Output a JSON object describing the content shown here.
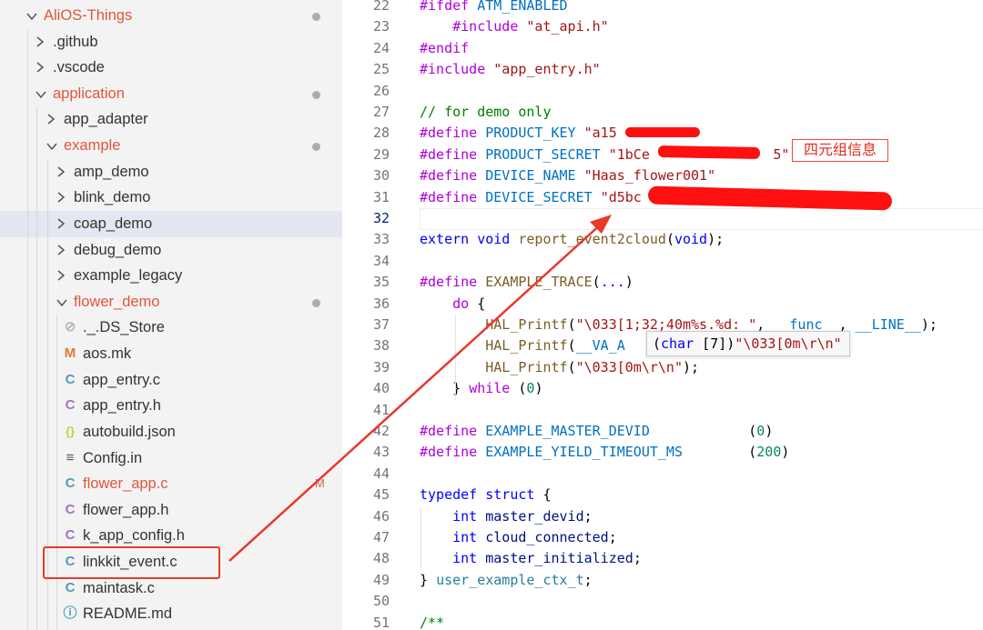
{
  "explorer": {
    "items": [
      {
        "label": "AliOS-Things",
        "kind": "folder-open",
        "depth": 0,
        "color": "#e0563b",
        "status": "dot"
      },
      {
        "label": ".github",
        "kind": "folder",
        "depth": 1,
        "color": "#333333"
      },
      {
        "label": ".vscode",
        "kind": "folder",
        "depth": 1,
        "color": "#333333"
      },
      {
        "label": "application",
        "kind": "folder-open",
        "depth": 1,
        "color": "#e0563b",
        "status": "dot"
      },
      {
        "label": "app_adapter",
        "kind": "folder",
        "depth": 2,
        "color": "#333333"
      },
      {
        "label": "example",
        "kind": "folder-open",
        "depth": 2,
        "color": "#e0563b",
        "status": "dot"
      },
      {
        "label": "amp_demo",
        "kind": "folder",
        "depth": 3,
        "color": "#333333"
      },
      {
        "label": "blink_demo",
        "kind": "folder",
        "depth": 3,
        "color": "#333333"
      },
      {
        "label": "coap_demo",
        "kind": "folder",
        "depth": 3,
        "color": "#333333",
        "selected": true
      },
      {
        "label": "debug_demo",
        "kind": "folder",
        "depth": 3,
        "color": "#333333"
      },
      {
        "label": "example_legacy",
        "kind": "folder",
        "depth": 3,
        "color": "#333333"
      },
      {
        "label": "flower_demo",
        "kind": "folder-open",
        "depth": 3,
        "color": "#e0563b",
        "status": "dot"
      },
      {
        "label": "._.DS_Store",
        "kind": "file",
        "icon": "hidden-eye-icon",
        "icon_char": "⊘",
        "icon_color": "#b7b7b7",
        "depth": 4,
        "color": "#333333"
      },
      {
        "label": "aos.mk",
        "kind": "file",
        "icon": "makefile-icon",
        "icon_char": "M",
        "icon_color": "#e37933",
        "depth": 4,
        "color": "#333333"
      },
      {
        "label": "app_entry.c",
        "kind": "file",
        "icon": "c-file-icon",
        "icon_char": "C",
        "icon_color": "#519aba",
        "depth": 4,
        "color": "#333333"
      },
      {
        "label": "app_entry.h",
        "kind": "file",
        "icon": "h-file-icon",
        "icon_char": "C",
        "icon_color": "#a074c4",
        "depth": 4,
        "color": "#333333"
      },
      {
        "label": "autobuild.json",
        "kind": "file",
        "icon": "json-file-icon",
        "icon_char": "{}",
        "icon_color": "#cbcb41",
        "depth": 4,
        "color": "#333333"
      },
      {
        "label": "Config.in",
        "kind": "file",
        "icon": "config-file-icon",
        "icon_char": "≡",
        "icon_color": "#555555",
        "depth": 4,
        "color": "#333333"
      },
      {
        "label": "flower_app.c",
        "kind": "file",
        "icon": "c-file-icon",
        "icon_char": "C",
        "icon_color": "#519aba",
        "depth": 4,
        "color": "#e0563b",
        "status": "M"
      },
      {
        "label": "flower_app.h",
        "kind": "file",
        "icon": "h-file-icon",
        "icon_char": "C",
        "icon_color": "#a074c4",
        "depth": 4,
        "color": "#333333"
      },
      {
        "label": "k_app_config.h",
        "kind": "file",
        "icon": "h-file-icon",
        "icon_char": "C",
        "icon_color": "#a074c4",
        "depth": 4,
        "color": "#333333"
      },
      {
        "label": "linkkit_event.c",
        "kind": "file",
        "icon": "c-file-icon",
        "icon_char": "C",
        "icon_color": "#519aba",
        "depth": 4,
        "color": "#333333",
        "highlighted": true
      },
      {
        "label": "maintask.c",
        "kind": "file",
        "icon": "c-file-icon",
        "icon_char": "C",
        "icon_color": "#519aba",
        "depth": 4,
        "color": "#333333"
      },
      {
        "label": "README.md",
        "kind": "file",
        "icon": "info-icon",
        "icon_char": "ⓘ",
        "icon_color": "#519aba",
        "depth": 4,
        "color": "#333333"
      }
    ]
  },
  "editor": {
    "current_line": 32,
    "lines": [
      {
        "n": "22",
        "indent": 0,
        "tokens": [
          [
            "pp",
            "#ifdef"
          ],
          [
            "tx",
            " "
          ],
          [
            "mc",
            "ATM_ENABLED"
          ]
        ]
      },
      {
        "n": "23",
        "indent": 1,
        "tokens": [
          [
            "pp",
            "    #include"
          ],
          [
            "tx",
            " "
          ],
          [
            "st",
            "\"at_api.h\""
          ]
        ]
      },
      {
        "n": "24",
        "indent": 0,
        "tokens": [
          [
            "pp",
            "#endif"
          ]
        ]
      },
      {
        "n": "25",
        "indent": 0,
        "tokens": [
          [
            "pp",
            "#include"
          ],
          [
            "tx",
            " "
          ],
          [
            "st",
            "\"app_entry.h\""
          ]
        ]
      },
      {
        "n": "26",
        "indent": 0,
        "tokens": []
      },
      {
        "n": "27",
        "indent": 0,
        "tokens": [
          [
            "cm",
            "// for demo only"
          ]
        ]
      },
      {
        "n": "28",
        "indent": 0,
        "tokens": [
          [
            "pp",
            "#define"
          ],
          [
            "tx",
            " "
          ],
          [
            "mc",
            "PRODUCT_KEY"
          ],
          [
            "tx",
            " "
          ],
          [
            "st",
            "\"a15"
          ]
        ]
      },
      {
        "n": "29",
        "indent": 0,
        "tokens": [
          [
            "pp",
            "#define"
          ],
          [
            "tx",
            " "
          ],
          [
            "mc",
            "PRODUCT_SECRET"
          ],
          [
            "tx",
            " "
          ],
          [
            "st",
            "\"1bCe               5\""
          ]
        ]
      },
      {
        "n": "30",
        "indent": 0,
        "tokens": [
          [
            "pp",
            "#define"
          ],
          [
            "tx",
            " "
          ],
          [
            "mc",
            "DEVICE_NAME"
          ],
          [
            "tx",
            " "
          ],
          [
            "st",
            "\"Haas_flower001\""
          ]
        ]
      },
      {
        "n": "31",
        "indent": 0,
        "tokens": [
          [
            "pp",
            "#define"
          ],
          [
            "tx",
            " "
          ],
          [
            "mc",
            "DEVICE_SECRET"
          ],
          [
            "tx",
            " "
          ],
          [
            "st",
            "\"d5bc                           \""
          ]
        ]
      },
      {
        "n": "32",
        "indent": 0,
        "tokens": []
      },
      {
        "n": "33",
        "indent": 0,
        "tokens": [
          [
            "kw",
            "extern"
          ],
          [
            "tx",
            " "
          ],
          [
            "ty",
            "void"
          ],
          [
            "tx",
            " "
          ],
          [
            "fn",
            "report_event2cloud"
          ],
          [
            "tx",
            "("
          ],
          [
            "ty",
            "void"
          ],
          [
            "tx",
            ");"
          ]
        ]
      },
      {
        "n": "34",
        "indent": 0,
        "tokens": []
      },
      {
        "n": "35",
        "indent": 0,
        "tokens": [
          [
            "pp",
            "#define"
          ],
          [
            "tx",
            " "
          ],
          [
            "fn",
            "EXAMPLE_TRACE"
          ],
          [
            "tx",
            "("
          ],
          [
            "kw",
            "..."
          ],
          [
            "tx",
            ")"
          ]
        ]
      },
      {
        "n": "36",
        "indent": 1,
        "tokens": [
          [
            "tx",
            "    "
          ],
          [
            "pp",
            "do"
          ],
          [
            "tx",
            " {"
          ]
        ]
      },
      {
        "n": "37",
        "indent": 2,
        "tokens": [
          [
            "tx",
            "        "
          ],
          [
            "fn",
            "HAL_Printf"
          ],
          [
            "tx",
            "("
          ],
          [
            "st",
            "\"\\033[1;32;40m%s.%d: \""
          ],
          [
            "tx",
            ", "
          ],
          [
            "mc",
            "__func__"
          ],
          [
            "tx",
            ", "
          ],
          [
            "mc",
            "__LINE__"
          ],
          [
            "tx",
            ");"
          ]
        ]
      },
      {
        "n": "38",
        "indent": 2,
        "tokens": [
          [
            "tx",
            "        "
          ],
          [
            "fn",
            "HAL_Printf"
          ],
          [
            "tx",
            "("
          ],
          [
            "mc",
            "__VA_A"
          ]
        ]
      },
      {
        "n": "39",
        "indent": 2,
        "tokens": [
          [
            "tx",
            "        "
          ],
          [
            "fn",
            "HAL_Printf"
          ],
          [
            "tx",
            "("
          ],
          [
            "st",
            "\"\\033[0m\\r\\n\""
          ],
          [
            "tx",
            ");"
          ]
        ]
      },
      {
        "n": "40",
        "indent": 1,
        "tokens": [
          [
            "tx",
            "    } "
          ],
          [
            "pp",
            "while"
          ],
          [
            "tx",
            " ("
          ],
          [
            "nu",
            "0"
          ],
          [
            "tx",
            ")"
          ]
        ]
      },
      {
        "n": "41",
        "indent": 0,
        "tokens": []
      },
      {
        "n": "42",
        "indent": 0,
        "tokens": [
          [
            "pp",
            "#define"
          ],
          [
            "tx",
            " "
          ],
          [
            "mc",
            "EXAMPLE_MASTER_DEVID"
          ],
          [
            "tx",
            "            ("
          ],
          [
            "nu",
            "0"
          ],
          [
            "tx",
            ")"
          ]
        ]
      },
      {
        "n": "43",
        "indent": 0,
        "tokens": [
          [
            "pp",
            "#define"
          ],
          [
            "tx",
            " "
          ],
          [
            "mc",
            "EXAMPLE_YIELD_TIMEOUT_MS"
          ],
          [
            "tx",
            "        ("
          ],
          [
            "nu",
            "200"
          ],
          [
            "tx",
            ")"
          ]
        ]
      },
      {
        "n": "44",
        "indent": 0,
        "tokens": []
      },
      {
        "n": "45",
        "indent": 0,
        "tokens": [
          [
            "kw",
            "typedef"
          ],
          [
            "tx",
            " "
          ],
          [
            "kw",
            "struct"
          ],
          [
            "tx",
            " {"
          ]
        ]
      },
      {
        "n": "46",
        "indent": 1,
        "tokens": [
          [
            "tx",
            "    "
          ],
          [
            "ty",
            "int"
          ],
          [
            "tx",
            " "
          ],
          [
            "va",
            "master_devid"
          ],
          [
            "tx",
            ";"
          ]
        ]
      },
      {
        "n": "47",
        "indent": 1,
        "tokens": [
          [
            "tx",
            "    "
          ],
          [
            "ty",
            "int"
          ],
          [
            "tx",
            " "
          ],
          [
            "va",
            "cloud_connected"
          ],
          [
            "tx",
            ";"
          ]
        ]
      },
      {
        "n": "48",
        "indent": 1,
        "tokens": [
          [
            "tx",
            "    "
          ],
          [
            "ty",
            "int"
          ],
          [
            "tx",
            " "
          ],
          [
            "va",
            "master_initialized"
          ],
          [
            "tx",
            ";"
          ]
        ]
      },
      {
        "n": "49",
        "indent": 0,
        "tokens": [
          [
            "tx",
            "} "
          ],
          [
            "ct",
            "user_example_ctx_t"
          ],
          [
            "tx",
            ";"
          ]
        ]
      },
      {
        "n": "50",
        "indent": 0,
        "tokens": []
      },
      {
        "n": "51",
        "indent": 0,
        "tokens": [
          [
            "cm",
            "/**"
          ]
        ]
      }
    ]
  },
  "hover_tooltip": {
    "tokens": [
      [
        "tx",
        "("
      ],
      [
        "kw",
        "char"
      ],
      [
        "tx",
        " [7])"
      ],
      [
        "st",
        "\"\\033[0m\\r\\n\""
      ]
    ]
  },
  "annotation": {
    "note_label": "四元组信息",
    "color": "#e8392a"
  }
}
